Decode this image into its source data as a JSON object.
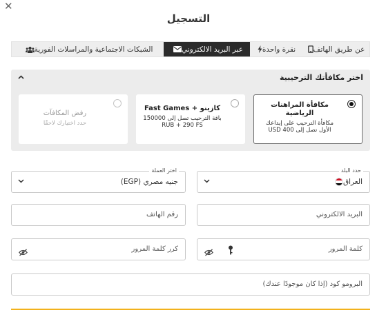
{
  "header": {
    "close_glyph": "✕",
    "title": "التسجيل"
  },
  "tabs": [
    {
      "label": "عن طريق الهاتف",
      "icon": "phone-icon",
      "active": false
    },
    {
      "label": "نقرة واحدة",
      "icon": "lightning-icon",
      "active": false
    },
    {
      "label": "عبر البريد الالكتروني",
      "icon": "envelope-icon",
      "active": true
    },
    {
      "label": "الشبكات الاجتماعية والمراسلات الفورية",
      "icon": "users-icon",
      "active": false
    }
  ],
  "bonus": {
    "title": "اختر مكافأتك الترحيبية",
    "options": [
      {
        "title_line1": "مكافأة المراهنات",
        "title_line2": "الرياضية",
        "desc_line1": "مكافأة الترحيب على إيداعك",
        "desc_line2": "الأول تصل إلى 400 USD",
        "selected": true
      },
      {
        "title_line1": "كازينو + Fast Games",
        "desc_line1": "باقة الترحيب تصل إلى 150000",
        "desc_line2": "RUB + 290 FS",
        "selected": false
      },
      {
        "title_line1": "رفض المكافآت",
        "desc_line1": "حدد اختيارك لاحقًا",
        "selected": false,
        "disabled": true
      }
    ]
  },
  "form": {
    "country": {
      "label": "حدد البلد",
      "value": "العراق",
      "flag_colors": [
        "#ce1126",
        "#ffffff",
        "#000000"
      ]
    },
    "currency": {
      "label": "اختر العملة",
      "value": "جنيه مصري (EGP)"
    },
    "email": {
      "placeholder": "البريد الالكتروني"
    },
    "phone": {
      "placeholder": "رقم الهاتف"
    },
    "password": {
      "placeholder": "كلمة المرور"
    },
    "password_repeat": {
      "placeholder": "كرر كلمة المرور"
    },
    "promo": {
      "placeholder": "البرومو كود (إذا كان موجودًا عندك)"
    }
  },
  "colors": {
    "accent": "#f2b21c",
    "active_tab": "#2b2b2b",
    "panel_bg": "#ececec"
  }
}
